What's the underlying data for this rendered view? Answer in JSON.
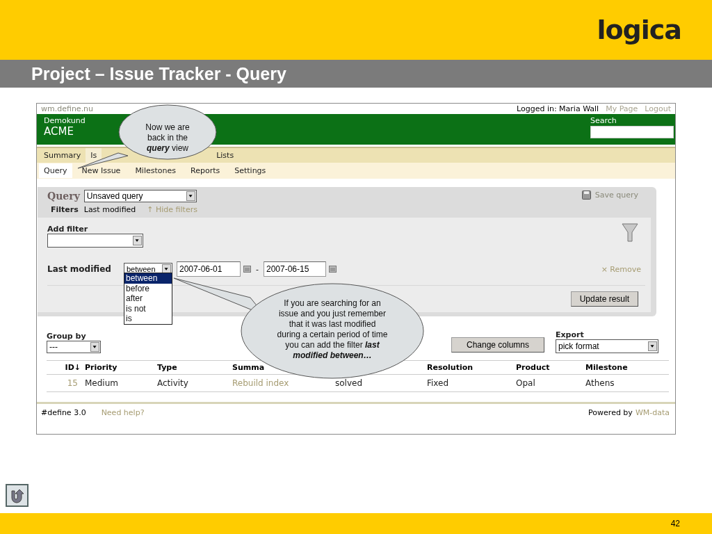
{
  "slide": {
    "title": "Project – Issue Tracker - Query",
    "logo": "logica",
    "page_number": "42"
  },
  "app": {
    "site": "wm.define.nu",
    "user_label": "Logged in: Maria Wall",
    "user_links": [
      "My Page",
      "Logout"
    ],
    "customer_label": "Demokund",
    "customer": "ACME",
    "search_label": "Search",
    "tabs": [
      {
        "label": "Summary",
        "selected": false
      },
      {
        "label": "Is",
        "selected": true
      },
      {
        "label": "Lists",
        "selected": false
      }
    ],
    "subtabs": [
      {
        "label": "Query",
        "selected": true
      },
      {
        "label": "New Issue",
        "selected": false
      },
      {
        "label": "Milestones",
        "selected": false
      },
      {
        "label": "Reports",
        "selected": false
      },
      {
        "label": "Settings",
        "selected": false
      }
    ],
    "query": {
      "title": "Query",
      "saved_query": "Unsaved query",
      "save_label": "Save query",
      "filters_label": "Filters",
      "active_filters": "Last modified",
      "toggle": "↑ Hide filters",
      "add_filter_label": "Add filter",
      "filter": {
        "label": "Last modified",
        "operator": "between",
        "from": "2007-06-01",
        "separator": "-",
        "to": "2007-06-15",
        "remove": "× Remove",
        "options": [
          {
            "label": "between",
            "selected": true
          },
          {
            "label": "before",
            "selected": false
          },
          {
            "label": "after",
            "selected": false
          },
          {
            "label": "is not",
            "selected": false
          },
          {
            "label": "is",
            "selected": false
          }
        ]
      },
      "update": "Update result"
    },
    "group_by": {
      "label": "Group by",
      "value": "---"
    },
    "change_columns": "Change columns",
    "export": {
      "label": "Export",
      "value": "pick format"
    },
    "table": {
      "columns": [
        "ID↓",
        "Priority",
        "Type",
        "Summa",
        "",
        "Resolution",
        "Product",
        "Milestone"
      ],
      "rows": [
        {
          "cells": [
            "15",
            "Medium",
            "Activity",
            "Rebuild index",
            "solved",
            "Fixed",
            "Opal",
            "Athens"
          ]
        }
      ]
    },
    "footer": {
      "version": "#define 3.0",
      "help": "Need help?",
      "powered_label": "Powered by",
      "powered_link": "WM-data"
    }
  },
  "callouts": [
    {
      "text": "Now we are back in the *query* view"
    },
    {
      "text": "If you are searching for an issue and you just remember that it was last modified during a certain period of time you can add the filter *last modified between…*"
    }
  ]
}
